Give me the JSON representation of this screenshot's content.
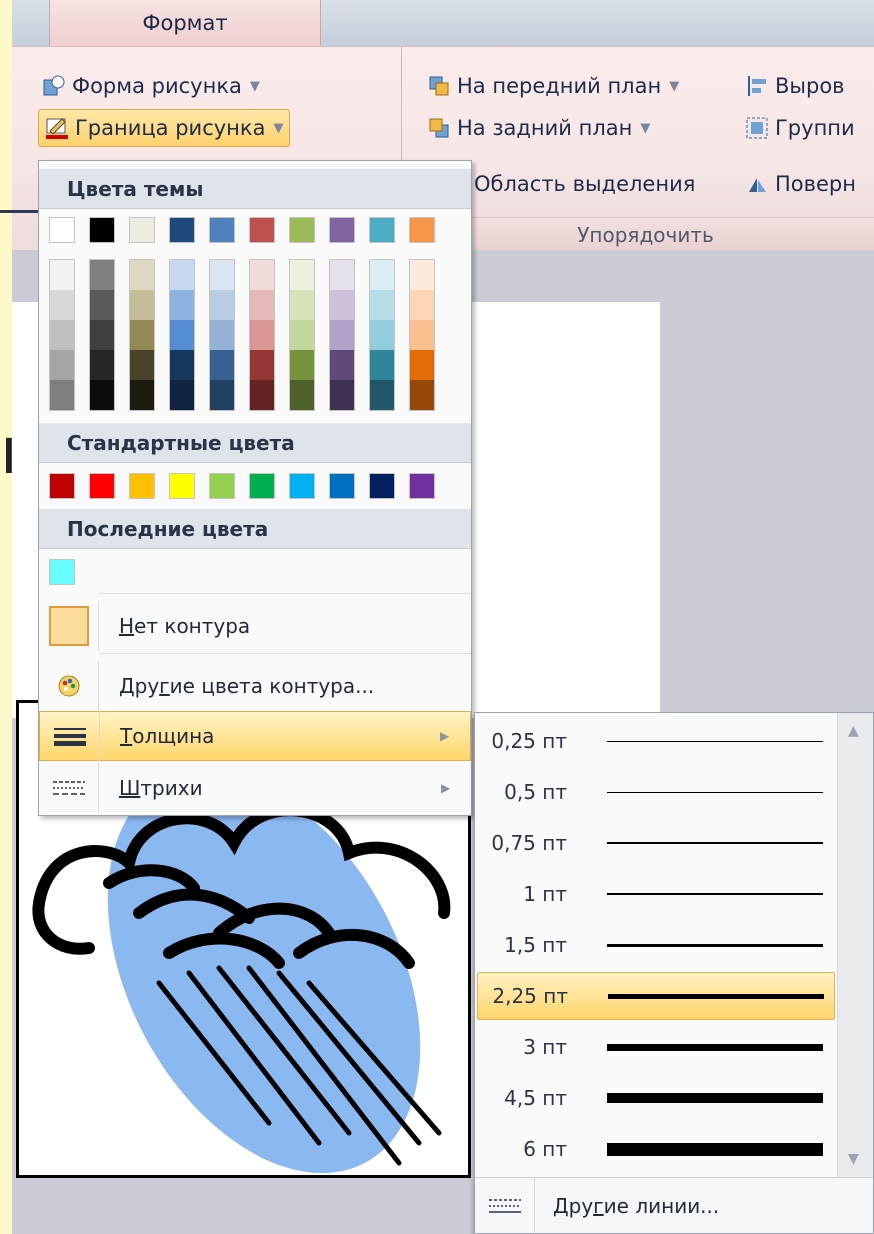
{
  "ribbon": {
    "tab_label": "Формат",
    "picture_shape": "Форма рисунка",
    "picture_border": "Граница рисунка",
    "bring_forward": "На передний план",
    "send_backward": "На задний план",
    "selection_pane": "Область выделения",
    "align": "Выров",
    "group": "Группи",
    "rotate": "Поверн",
    "arrange_group_label": "Упорядочить"
  },
  "menu": {
    "theme_colors_header": "Цвета темы",
    "standard_colors_header": "Стандартные цвета",
    "recent_colors_header": "Последние цвета",
    "theme_top_row": [
      "#ffffff",
      "#000000",
      "#eeece1",
      "#1f497d",
      "#4f81bd",
      "#c0504d",
      "#9bbb59",
      "#8064a2",
      "#4bacc6",
      "#f79646"
    ],
    "theme_shades": [
      [
        "#f2f2f2",
        "#d8d8d8",
        "#bfbfbf",
        "#a5a5a5",
        "#7f7f7f"
      ],
      [
        "#7f7f7f",
        "#595959",
        "#3f3f3f",
        "#262626",
        "#0c0c0c"
      ],
      [
        "#ddd9c3",
        "#c4bd97",
        "#938953",
        "#494429",
        "#1d1b10"
      ],
      [
        "#c6d9f0",
        "#8db3e2",
        "#548dd4",
        "#17365d",
        "#0f243e"
      ],
      [
        "#dbe5f1",
        "#b8cce4",
        "#95b3d7",
        "#366092",
        "#244061"
      ],
      [
        "#f2dcdb",
        "#e5b9b7",
        "#d99694",
        "#953734",
        "#632423"
      ],
      [
        "#ebf1dd",
        "#d7e3bc",
        "#c3d69b",
        "#76923c",
        "#4f6128"
      ],
      [
        "#e5e0ec",
        "#ccc1d9",
        "#b2a2c7",
        "#5f497a",
        "#3f3151"
      ],
      [
        "#dbeef3",
        "#b7dde8",
        "#92cddc",
        "#31859b",
        "#205867"
      ],
      [
        "#fdeada",
        "#fbd5b5",
        "#fac08f",
        "#e36c09",
        "#974806"
      ]
    ],
    "standard_colors": [
      "#c00000",
      "#ff0000",
      "#ffc000",
      "#ffff00",
      "#92d050",
      "#00b050",
      "#00b0f0",
      "#0070c0",
      "#002060",
      "#7030a0"
    ],
    "recent_colors": [
      "#66ffff"
    ],
    "no_outline_prefix": "Н",
    "no_outline_rest": "ет контура",
    "more_colors_prefix": "Дру",
    "more_colors_key": "г",
    "more_colors_rest": "ие цвета контура...",
    "weight_key": "Т",
    "weight_rest": "олщина",
    "dashes_key": "Ш",
    "dashes_rest": "трихи"
  },
  "weights": {
    "options": [
      {
        "label": "0,25 пт",
        "pt": 0.25
      },
      {
        "label": "0,5 пт",
        "pt": 0.5
      },
      {
        "label": "0,75 пт",
        "pt": 0.75
      },
      {
        "label": "1 пт",
        "pt": 1
      },
      {
        "label": "1,5 пт",
        "pt": 1.5
      },
      {
        "label": "2,25 пт",
        "pt": 2.25
      },
      {
        "label": "3 пт",
        "pt": 3
      },
      {
        "label": "4,5 пт",
        "pt": 4.5
      },
      {
        "label": "6 пт",
        "pt": 6
      }
    ],
    "selected": "2,25 пт",
    "more_lines_prefix": "Дру",
    "more_lines_key": "г",
    "more_lines_rest": "ие линии..."
  },
  "slide": {
    "partial_text": "ı"
  }
}
